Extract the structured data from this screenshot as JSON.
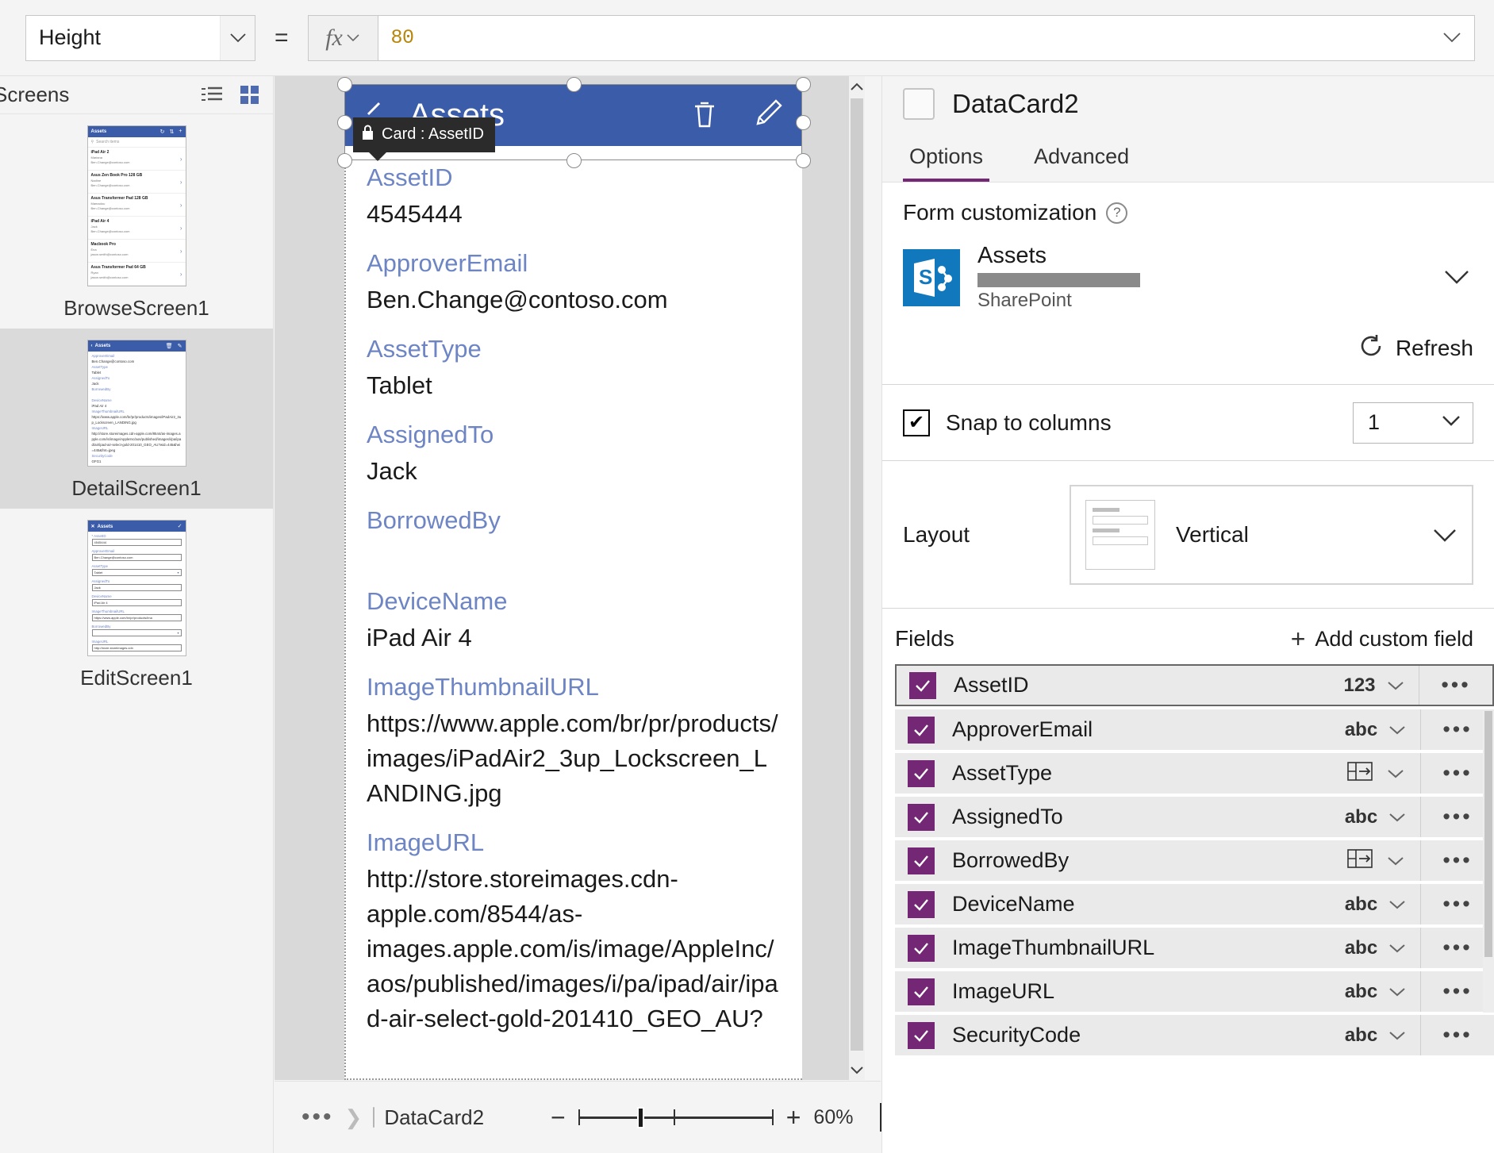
{
  "formula_bar": {
    "property": "Height",
    "equals": "=",
    "fx_label": "fx",
    "value": "80"
  },
  "screens_panel": {
    "title": "Screens",
    "icons": [
      "tree-view-icon",
      "grid-view-icon"
    ],
    "screens": [
      {
        "name": "BrowseScreen1",
        "type": "browse",
        "header_title": "Assets",
        "search_placeholder": "Search items",
        "rows": [
          {
            "title": "iPad Air 2",
            "person": "Mariana",
            "email": "Ben.Change@contoso.com"
          },
          {
            "title": "Asus Zen Book Pro 128 GB",
            "person": "Nadine",
            "email": "Ben.Change@contoso.com"
          },
          {
            "title": "Asus Transformer Pad 128 GB",
            "person": "Mamadou",
            "email": "Ben.Change@contoso.com"
          },
          {
            "title": "iPad Air 4",
            "person": "Jack",
            "email": "Ben.Change@contoso.com"
          },
          {
            "title": "Macbook Pro",
            "person": "Ena",
            "email": "jason.smith@contoso.com"
          },
          {
            "title": "Asus Transformer Pad 64 GB",
            "person": "Ryan",
            "email": "jason.smith@contoso.com"
          }
        ]
      },
      {
        "name": "DetailScreen1",
        "type": "detail",
        "header_title": "Assets",
        "fields": [
          {
            "label": "ApproverEmail",
            "value": "Ben.Change@contoso.com"
          },
          {
            "label": "AssetType",
            "value": "Tablet"
          },
          {
            "label": "AssignedTo",
            "value": "Jack"
          },
          {
            "label": "BorrowedBy",
            "value": ""
          },
          {
            "label": "DeviceName",
            "value": "iPad Air 4"
          },
          {
            "label": "ImageThumbnailURL",
            "value": "https://www.apple.com/br/pr/products/images/iPadAir2_3up_Lockscreen_LANDING.jpg"
          },
          {
            "label": "ImageURL",
            "value": "http://store.storeimages.cdn-apple.com/8544/as-images.apple.com/is/image/AppleInc/aos/published/images/i/pa/ipad/air/ipad-air-select-gold-201410_GEO_AU?wid=445&hei=445&fmt=jpeg"
          },
          {
            "label": "SecurityCode",
            "value": "GFG1"
          }
        ]
      },
      {
        "name": "EditScreen1",
        "type": "edit",
        "header_title": "Assets",
        "fields": [
          {
            "label": "AssetID",
            "value": "4545444",
            "required": true,
            "control": "text"
          },
          {
            "label": "ApproverEmail",
            "value": "Ben.Change@contoso.com",
            "control": "text"
          },
          {
            "label": "AssetType",
            "value": "Tablet",
            "control": "dropdown"
          },
          {
            "label": "AssignedTo",
            "value": "Jack",
            "control": "text"
          },
          {
            "label": "DeviceName",
            "value": "iPad Air 4",
            "control": "text"
          },
          {
            "label": "ImageThumbnailURL",
            "value": "https://www.apple.com/br/pr/products/ima",
            "control": "text"
          },
          {
            "label": "BorrowedBy",
            "value": "",
            "control": "dropdown"
          },
          {
            "label": "ImageURL",
            "value": "http://store.storeimages.cdn",
            "control": "text"
          }
        ]
      }
    ]
  },
  "canvas": {
    "tooltip": "Card : AssetID",
    "tooltip_icon": "lock-icon",
    "screen_header": {
      "title": "Assets",
      "back_icon": "back-chevron-icon",
      "delete_icon": "trash-icon",
      "edit_icon": "pencil-icon"
    },
    "form_fields": [
      {
        "label": "AssetID",
        "value": "4545444"
      },
      {
        "label": "ApproverEmail",
        "value": "Ben.Change@contoso.com"
      },
      {
        "label": "AssetType",
        "value": "Tablet"
      },
      {
        "label": "AssignedTo",
        "value": "Jack"
      },
      {
        "label": "BorrowedBy",
        "value": ""
      },
      {
        "label": "DeviceName",
        "value": "iPad Air 4"
      },
      {
        "label": "ImageThumbnailURL",
        "value": "https://www.apple.com/br/pr/products/images/iPadAir2_3up_Lockscreen_LANDING.jpg"
      },
      {
        "label": "ImageURL",
        "value": "http://store.storeimages.cdn-apple.com/8544/as-images.apple.com/is/image/AppleInc/aos/published/images/i/pa/ipad/air/ipad-air-select-gold-201410_GEO_AU?"
      }
    ]
  },
  "bottom_bar": {
    "overflow": "•••",
    "breadcrumb_item": "DataCard2",
    "zoom_minus": "−",
    "zoom_plus": "+",
    "zoom_level": "60%",
    "fit_icon": "fit-to-screen-icon"
  },
  "right_panel": {
    "title": "DataCard2",
    "tabs": [
      {
        "label": "Options",
        "active": true
      },
      {
        "label": "Advanced",
        "active": false
      }
    ],
    "form_customization": {
      "heading": "Form customization",
      "help_icon": "help-icon",
      "data_source": {
        "icon": "sharepoint-icon",
        "name": "Assets",
        "url_redacted": true,
        "kind": "SharePoint",
        "expand_icon": "chevron-down-icon"
      },
      "refresh": {
        "label": "Refresh",
        "icon": "refresh-icon"
      }
    },
    "snap_to_columns": {
      "label": "Snap to columns",
      "checked": true,
      "columns_value": "1"
    },
    "layout": {
      "label": "Layout",
      "value": "Vertical",
      "preview_icon": "vertical-layout-icon"
    },
    "fields": {
      "heading": "Fields",
      "add_custom_field": "Add custom field",
      "add_icon": "plus-icon",
      "items": [
        {
          "name": "AssetID",
          "checked": true,
          "type": "123",
          "type_kind": "number",
          "selected": true
        },
        {
          "name": "ApproverEmail",
          "checked": true,
          "type": "abc",
          "type_kind": "text",
          "selected": false
        },
        {
          "name": "AssetType",
          "checked": true,
          "type": "",
          "type_kind": "lookup",
          "selected": false
        },
        {
          "name": "AssignedTo",
          "checked": true,
          "type": "abc",
          "type_kind": "text",
          "selected": false
        },
        {
          "name": "BorrowedBy",
          "checked": true,
          "type": "",
          "type_kind": "lookup",
          "selected": false
        },
        {
          "name": "DeviceName",
          "checked": true,
          "type": "abc",
          "type_kind": "text",
          "selected": false
        },
        {
          "name": "ImageThumbnailURL",
          "checked": true,
          "type": "abc",
          "type_kind": "text",
          "selected": false
        },
        {
          "name": "ImageURL",
          "checked": true,
          "type": "abc",
          "type_kind": "text",
          "selected": false
        },
        {
          "name": "SecurityCode",
          "checked": true,
          "type": "abc",
          "type_kind": "text",
          "selected": false
        }
      ],
      "row_menu_icon": "ellipsis-icon",
      "row_chevron_icon": "chevron-down-icon"
    }
  },
  "colors": {
    "accent_purple": "#742774",
    "header_blue": "#3b5ca8",
    "label_blue": "#6e85c4",
    "formula_orange": "#b8860b",
    "sharepoint_blue": "#1278be"
  }
}
